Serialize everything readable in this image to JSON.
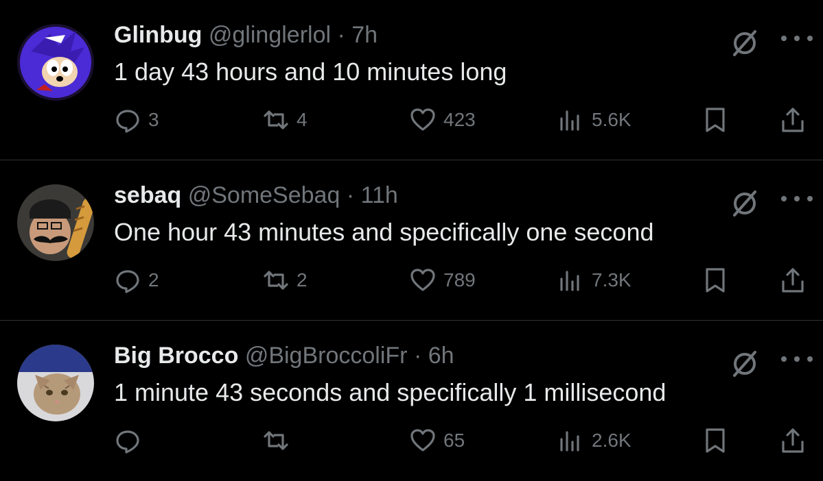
{
  "tweets": [
    {
      "name": "Glinbug",
      "handle": "@glinglerlol",
      "dot": "·",
      "time": "7h",
      "text": "1 day 43 hours and 10 minutes long",
      "replies": "3",
      "retweets": "4",
      "likes": "423",
      "views": "5.6K",
      "avatar_icon": "cartoon-hedgehog-avatar",
      "avatar_color": "#4a2bd6"
    },
    {
      "name": "sebaq",
      "handle": "@SomeSebaq",
      "dot": "·",
      "time": "11h",
      "text": "One hour 43 minutes and specifically one second",
      "replies": "2",
      "retweets": "2",
      "likes": "789",
      "views": "7.3K",
      "avatar_icon": "man-with-baguette-avatar",
      "avatar_color": "#5a4a3a"
    },
    {
      "name": "Big Brocco",
      "handle": "@BigBroccoliFr",
      "dot": "·",
      "time": "6h",
      "text": "1 minute 43 seconds and specifically 1 millisecond",
      "replies": "",
      "retweets": "",
      "likes": "65",
      "views": "2.6K",
      "avatar_icon": "cat-avatar",
      "avatar_color": "#9a8a78"
    }
  ],
  "icons": {
    "reply": "reply-icon",
    "retweet": "retweet-icon",
    "like": "heart-icon",
    "views": "views-icon",
    "bookmark": "bookmark-icon",
    "share": "share-icon",
    "grok": "grok-icon",
    "more": "more-icon"
  },
  "colors": {
    "background": "#000000",
    "text": "#e7e9ea",
    "secondary": "#71767b",
    "divider": "#2f3336"
  }
}
